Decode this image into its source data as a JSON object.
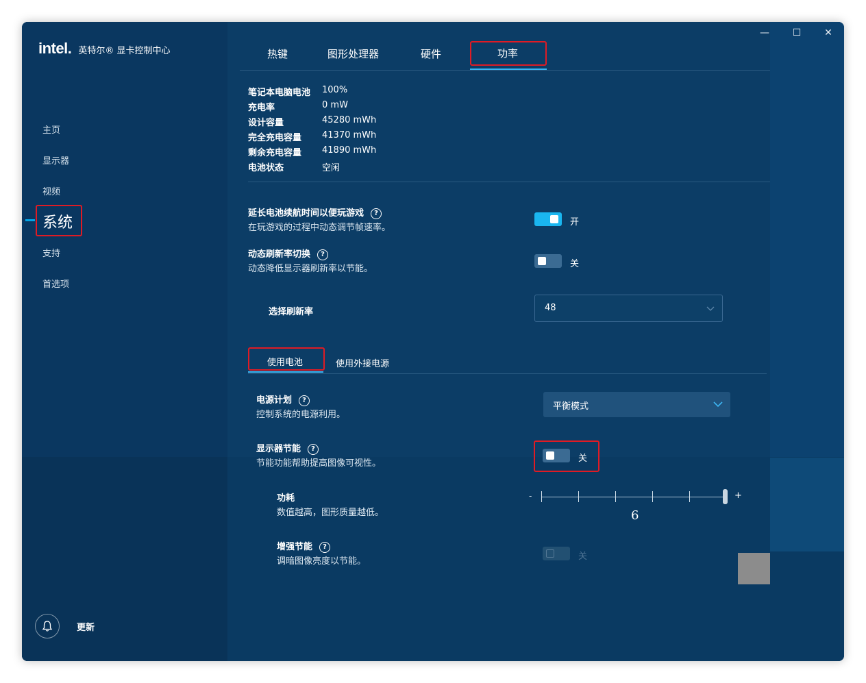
{
  "app": {
    "logo": "intel.",
    "title": "英特尔® 显卡控制中心"
  },
  "window_controls": {
    "minimize": "—",
    "maximize": "☐",
    "close": "✕"
  },
  "sidebar": {
    "items": [
      {
        "label": "主页"
      },
      {
        "label": "显示器"
      },
      {
        "label": "视频"
      },
      {
        "label": "系统",
        "active": true
      },
      {
        "label": "支持"
      },
      {
        "label": "首选项"
      }
    ],
    "update_label": "更新",
    "bell_icon": "bell-icon"
  },
  "tabs": [
    {
      "label": "热键"
    },
    {
      "label": "图形处理器"
    },
    {
      "label": "硬件"
    },
    {
      "label": "功率",
      "active": true
    }
  ],
  "battery_info": [
    {
      "key": "笔记本电脑电池",
      "value": "100%"
    },
    {
      "key": "充电率",
      "value": "0 mW"
    },
    {
      "key": "设计容量",
      "value": "45280 mWh"
    },
    {
      "key": "完全充电容量",
      "value": "41370 mWh"
    },
    {
      "key": "剩余充电容量",
      "value": "41890 mWh"
    },
    {
      "key": "电池状态",
      "value": "空闲"
    }
  ],
  "settings": {
    "extend_battery": {
      "title": "延长电池续航时间以便玩游戏",
      "desc": "在玩游戏的过程中动态调节帧速率。",
      "state": "开",
      "on": true
    },
    "dynamic_refresh": {
      "title": "动态刷新率切换",
      "desc": "动态降低显示器刷新率以节能。",
      "state": "关",
      "on": false
    },
    "refresh_rate": {
      "label": "选择刷新率",
      "value": "48"
    }
  },
  "power_tabs": [
    {
      "label": "使用电池",
      "active": true
    },
    {
      "label": "使用外接电源"
    }
  ],
  "power_settings": {
    "power_plan": {
      "title": "电源计划",
      "desc": "控制系统的电源利用。",
      "value": "平衡模式"
    },
    "display_saving": {
      "title": "显示器节能",
      "desc": "节能功能帮助提高图像可视性。",
      "state": "关",
      "on": false
    },
    "power_consumption": {
      "title": "功耗",
      "desc": "数值越高，图形质量越低。",
      "min_label": "-",
      "max_label": "+",
      "value": "6"
    },
    "enhanced_saving": {
      "title": "增强节能",
      "desc": "调暗图像亮度以节能。",
      "state": "关",
      "on": false,
      "disabled": true
    }
  },
  "help_glyph": "?",
  "colors": {
    "background": "#0c3d66",
    "accent": "#1ab6f0",
    "highlight": "#e01b24"
  }
}
